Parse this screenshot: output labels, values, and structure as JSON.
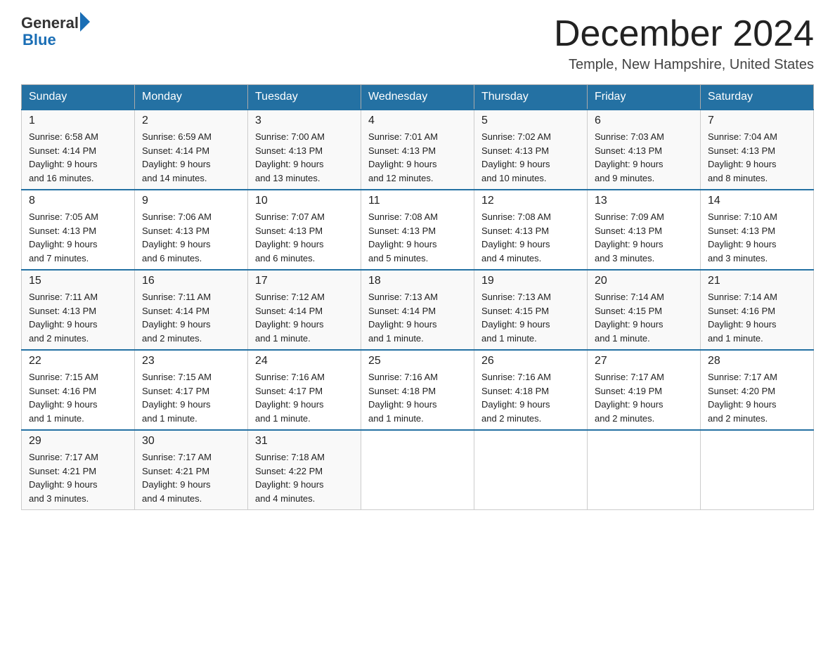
{
  "logo": {
    "general": "General",
    "blue": "Blue"
  },
  "title": "December 2024",
  "location": "Temple, New Hampshire, United States",
  "headers": [
    "Sunday",
    "Monday",
    "Tuesday",
    "Wednesday",
    "Thursday",
    "Friday",
    "Saturday"
  ],
  "rows": [
    [
      {
        "day": "1",
        "sunrise": "6:58 AM",
        "sunset": "4:14 PM",
        "daylight": "9 hours and 16 minutes."
      },
      {
        "day": "2",
        "sunrise": "6:59 AM",
        "sunset": "4:14 PM",
        "daylight": "9 hours and 14 minutes."
      },
      {
        "day": "3",
        "sunrise": "7:00 AM",
        "sunset": "4:13 PM",
        "daylight": "9 hours and 13 minutes."
      },
      {
        "day": "4",
        "sunrise": "7:01 AM",
        "sunset": "4:13 PM",
        "daylight": "9 hours and 12 minutes."
      },
      {
        "day": "5",
        "sunrise": "7:02 AM",
        "sunset": "4:13 PM",
        "daylight": "9 hours and 10 minutes."
      },
      {
        "day": "6",
        "sunrise": "7:03 AM",
        "sunset": "4:13 PM",
        "daylight": "9 hours and 9 minutes."
      },
      {
        "day": "7",
        "sunrise": "7:04 AM",
        "sunset": "4:13 PM",
        "daylight": "9 hours and 8 minutes."
      }
    ],
    [
      {
        "day": "8",
        "sunrise": "7:05 AM",
        "sunset": "4:13 PM",
        "daylight": "9 hours and 7 minutes."
      },
      {
        "day": "9",
        "sunrise": "7:06 AM",
        "sunset": "4:13 PM",
        "daylight": "9 hours and 6 minutes."
      },
      {
        "day": "10",
        "sunrise": "7:07 AM",
        "sunset": "4:13 PM",
        "daylight": "9 hours and 6 minutes."
      },
      {
        "day": "11",
        "sunrise": "7:08 AM",
        "sunset": "4:13 PM",
        "daylight": "9 hours and 5 minutes."
      },
      {
        "day": "12",
        "sunrise": "7:08 AM",
        "sunset": "4:13 PM",
        "daylight": "9 hours and 4 minutes."
      },
      {
        "day": "13",
        "sunrise": "7:09 AM",
        "sunset": "4:13 PM",
        "daylight": "9 hours and 3 minutes."
      },
      {
        "day": "14",
        "sunrise": "7:10 AM",
        "sunset": "4:13 PM",
        "daylight": "9 hours and 3 minutes."
      }
    ],
    [
      {
        "day": "15",
        "sunrise": "7:11 AM",
        "sunset": "4:13 PM",
        "daylight": "9 hours and 2 minutes."
      },
      {
        "day": "16",
        "sunrise": "7:11 AM",
        "sunset": "4:14 PM",
        "daylight": "9 hours and 2 minutes."
      },
      {
        "day": "17",
        "sunrise": "7:12 AM",
        "sunset": "4:14 PM",
        "daylight": "9 hours and 1 minute."
      },
      {
        "day": "18",
        "sunrise": "7:13 AM",
        "sunset": "4:14 PM",
        "daylight": "9 hours and 1 minute."
      },
      {
        "day": "19",
        "sunrise": "7:13 AM",
        "sunset": "4:15 PM",
        "daylight": "9 hours and 1 minute."
      },
      {
        "day": "20",
        "sunrise": "7:14 AM",
        "sunset": "4:15 PM",
        "daylight": "9 hours and 1 minute."
      },
      {
        "day": "21",
        "sunrise": "7:14 AM",
        "sunset": "4:16 PM",
        "daylight": "9 hours and 1 minute."
      }
    ],
    [
      {
        "day": "22",
        "sunrise": "7:15 AM",
        "sunset": "4:16 PM",
        "daylight": "9 hours and 1 minute."
      },
      {
        "day": "23",
        "sunrise": "7:15 AM",
        "sunset": "4:17 PM",
        "daylight": "9 hours and 1 minute."
      },
      {
        "day": "24",
        "sunrise": "7:16 AM",
        "sunset": "4:17 PM",
        "daylight": "9 hours and 1 minute."
      },
      {
        "day": "25",
        "sunrise": "7:16 AM",
        "sunset": "4:18 PM",
        "daylight": "9 hours and 1 minute."
      },
      {
        "day": "26",
        "sunrise": "7:16 AM",
        "sunset": "4:18 PM",
        "daylight": "9 hours and 2 minutes."
      },
      {
        "day": "27",
        "sunrise": "7:17 AM",
        "sunset": "4:19 PM",
        "daylight": "9 hours and 2 minutes."
      },
      {
        "day": "28",
        "sunrise": "7:17 AM",
        "sunset": "4:20 PM",
        "daylight": "9 hours and 2 minutes."
      }
    ],
    [
      {
        "day": "29",
        "sunrise": "7:17 AM",
        "sunset": "4:21 PM",
        "daylight": "9 hours and 3 minutes."
      },
      {
        "day": "30",
        "sunrise": "7:17 AM",
        "sunset": "4:21 PM",
        "daylight": "9 hours and 4 minutes."
      },
      {
        "day": "31",
        "sunrise": "7:18 AM",
        "sunset": "4:22 PM",
        "daylight": "9 hours and 4 minutes."
      },
      null,
      null,
      null,
      null
    ]
  ],
  "sunrise_label": "Sunrise:",
  "sunset_label": "Sunset:",
  "daylight_label": "Daylight:"
}
